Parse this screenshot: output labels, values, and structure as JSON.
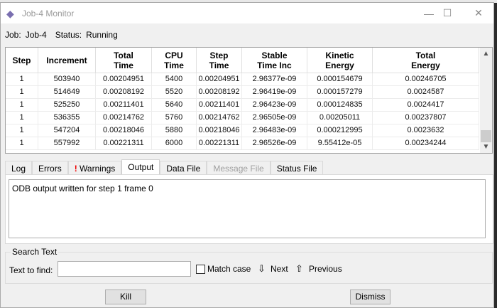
{
  "window": {
    "title": "Job-4 Monitor",
    "minimize": "—",
    "maximize": "☐",
    "close": "✕"
  },
  "status": {
    "job_label": "Job:",
    "job": "Job-4",
    "status_label": "Status:",
    "status": "Running"
  },
  "table": {
    "headers": [
      [
        "Step",
        ""
      ],
      [
        "Increment",
        ""
      ],
      [
        "Total",
        "Time"
      ],
      [
        "CPU",
        "Time"
      ],
      [
        "Step",
        "Time"
      ],
      [
        "Stable",
        "Time Inc"
      ],
      [
        "Kinetic",
        "Energy"
      ],
      [
        "Total",
        "Energy"
      ]
    ],
    "rows": [
      [
        "1",
        "503940",
        "0.00204951",
        "5400",
        "0.00204951",
        "2.96377e-09",
        "0.000154679",
        "0.00246705"
      ],
      [
        "1",
        "514649",
        "0.00208192",
        "5520",
        "0.00208192",
        "2.96419e-09",
        "0.000157279",
        "0.0024587"
      ],
      [
        "1",
        "525250",
        "0.00211401",
        "5640",
        "0.00211401",
        "2.96423e-09",
        "0.000124835",
        "0.0024417"
      ],
      [
        "1",
        "536355",
        "0.00214762",
        "5760",
        "0.00214762",
        "2.96505e-09",
        "0.00205011",
        "0.00237807"
      ],
      [
        "1",
        "547204",
        "0.00218046",
        "5880",
        "0.00218046",
        "2.96483e-09",
        "0.000212995",
        "0.0023632"
      ],
      [
        "1",
        "557992",
        "0.00221311",
        "6000",
        "0.00221311",
        "2.96526e-09",
        "9.55412e-05",
        "0.00234244"
      ]
    ]
  },
  "tabs": [
    {
      "label": "Log"
    },
    {
      "label": "Errors"
    },
    {
      "label": "Warnings",
      "mark": "!"
    },
    {
      "label": "Output",
      "active": true
    },
    {
      "label": "Data File"
    },
    {
      "label": "Message File",
      "disabled": true
    },
    {
      "label": "Status File"
    }
  ],
  "output": {
    "text": "ODB output written for step 1 frame 0"
  },
  "search": {
    "group_label": "Search Text",
    "find_label": "Text to find:",
    "value": "",
    "match_case": "Match case",
    "next": "Next",
    "previous": "Previous"
  },
  "buttons": {
    "kill": "Kill",
    "dismiss": "Dismiss"
  }
}
